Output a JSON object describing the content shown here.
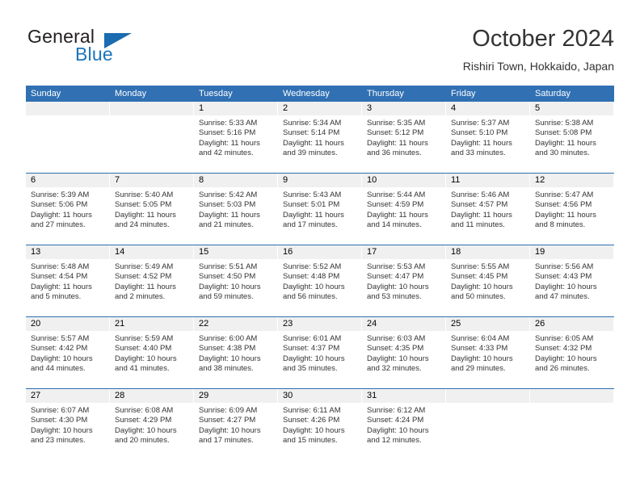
{
  "brand": {
    "name_part1": "General",
    "name_part2": "Blue"
  },
  "header": {
    "title": "October 2024",
    "subtitle": "Rishiri Town, Hokkaido, Japan"
  },
  "colors": {
    "header_blue": "#3070b3",
    "row_divider_blue": "#2f6fb0",
    "daynum_band": "#f0f0f0",
    "brand_blue": "#1b75bb",
    "text": "#333333"
  },
  "weekdays": [
    "Sunday",
    "Monday",
    "Tuesday",
    "Wednesday",
    "Thursday",
    "Friday",
    "Saturday"
  ],
  "weeks": [
    [
      {
        "day": "",
        "sunrise": "",
        "sunset": "",
        "daylight": "",
        "empty": true
      },
      {
        "day": "",
        "sunrise": "",
        "sunset": "",
        "daylight": "",
        "empty": true
      },
      {
        "day": "1",
        "sunrise": "Sunrise: 5:33 AM",
        "sunset": "Sunset: 5:16 PM",
        "daylight": "Daylight: 11 hours and 42 minutes."
      },
      {
        "day": "2",
        "sunrise": "Sunrise: 5:34 AM",
        "sunset": "Sunset: 5:14 PM",
        "daylight": "Daylight: 11 hours and 39 minutes."
      },
      {
        "day": "3",
        "sunrise": "Sunrise: 5:35 AM",
        "sunset": "Sunset: 5:12 PM",
        "daylight": "Daylight: 11 hours and 36 minutes."
      },
      {
        "day": "4",
        "sunrise": "Sunrise: 5:37 AM",
        "sunset": "Sunset: 5:10 PM",
        "daylight": "Daylight: 11 hours and 33 minutes."
      },
      {
        "day": "5",
        "sunrise": "Sunrise: 5:38 AM",
        "sunset": "Sunset: 5:08 PM",
        "daylight": "Daylight: 11 hours and 30 minutes."
      }
    ],
    [
      {
        "day": "6",
        "sunrise": "Sunrise: 5:39 AM",
        "sunset": "Sunset: 5:06 PM",
        "daylight": "Daylight: 11 hours and 27 minutes."
      },
      {
        "day": "7",
        "sunrise": "Sunrise: 5:40 AM",
        "sunset": "Sunset: 5:05 PM",
        "daylight": "Daylight: 11 hours and 24 minutes."
      },
      {
        "day": "8",
        "sunrise": "Sunrise: 5:42 AM",
        "sunset": "Sunset: 5:03 PM",
        "daylight": "Daylight: 11 hours and 21 minutes."
      },
      {
        "day": "9",
        "sunrise": "Sunrise: 5:43 AM",
        "sunset": "Sunset: 5:01 PM",
        "daylight": "Daylight: 11 hours and 17 minutes."
      },
      {
        "day": "10",
        "sunrise": "Sunrise: 5:44 AM",
        "sunset": "Sunset: 4:59 PM",
        "daylight": "Daylight: 11 hours and 14 minutes."
      },
      {
        "day": "11",
        "sunrise": "Sunrise: 5:46 AM",
        "sunset": "Sunset: 4:57 PM",
        "daylight": "Daylight: 11 hours and 11 minutes."
      },
      {
        "day": "12",
        "sunrise": "Sunrise: 5:47 AM",
        "sunset": "Sunset: 4:56 PM",
        "daylight": "Daylight: 11 hours and 8 minutes."
      }
    ],
    [
      {
        "day": "13",
        "sunrise": "Sunrise: 5:48 AM",
        "sunset": "Sunset: 4:54 PM",
        "daylight": "Daylight: 11 hours and 5 minutes."
      },
      {
        "day": "14",
        "sunrise": "Sunrise: 5:49 AM",
        "sunset": "Sunset: 4:52 PM",
        "daylight": "Daylight: 11 hours and 2 minutes."
      },
      {
        "day": "15",
        "sunrise": "Sunrise: 5:51 AM",
        "sunset": "Sunset: 4:50 PM",
        "daylight": "Daylight: 10 hours and 59 minutes."
      },
      {
        "day": "16",
        "sunrise": "Sunrise: 5:52 AM",
        "sunset": "Sunset: 4:48 PM",
        "daylight": "Daylight: 10 hours and 56 minutes."
      },
      {
        "day": "17",
        "sunrise": "Sunrise: 5:53 AM",
        "sunset": "Sunset: 4:47 PM",
        "daylight": "Daylight: 10 hours and 53 minutes."
      },
      {
        "day": "18",
        "sunrise": "Sunrise: 5:55 AM",
        "sunset": "Sunset: 4:45 PM",
        "daylight": "Daylight: 10 hours and 50 minutes."
      },
      {
        "day": "19",
        "sunrise": "Sunrise: 5:56 AM",
        "sunset": "Sunset: 4:43 PM",
        "daylight": "Daylight: 10 hours and 47 minutes."
      }
    ],
    [
      {
        "day": "20",
        "sunrise": "Sunrise: 5:57 AM",
        "sunset": "Sunset: 4:42 PM",
        "daylight": "Daylight: 10 hours and 44 minutes."
      },
      {
        "day": "21",
        "sunrise": "Sunrise: 5:59 AM",
        "sunset": "Sunset: 4:40 PM",
        "daylight": "Daylight: 10 hours and 41 minutes."
      },
      {
        "day": "22",
        "sunrise": "Sunrise: 6:00 AM",
        "sunset": "Sunset: 4:38 PM",
        "daylight": "Daylight: 10 hours and 38 minutes."
      },
      {
        "day": "23",
        "sunrise": "Sunrise: 6:01 AM",
        "sunset": "Sunset: 4:37 PM",
        "daylight": "Daylight: 10 hours and 35 minutes."
      },
      {
        "day": "24",
        "sunrise": "Sunrise: 6:03 AM",
        "sunset": "Sunset: 4:35 PM",
        "daylight": "Daylight: 10 hours and 32 minutes."
      },
      {
        "day": "25",
        "sunrise": "Sunrise: 6:04 AM",
        "sunset": "Sunset: 4:33 PM",
        "daylight": "Daylight: 10 hours and 29 minutes."
      },
      {
        "day": "26",
        "sunrise": "Sunrise: 6:05 AM",
        "sunset": "Sunset: 4:32 PM",
        "daylight": "Daylight: 10 hours and 26 minutes."
      }
    ],
    [
      {
        "day": "27",
        "sunrise": "Sunrise: 6:07 AM",
        "sunset": "Sunset: 4:30 PM",
        "daylight": "Daylight: 10 hours and 23 minutes."
      },
      {
        "day": "28",
        "sunrise": "Sunrise: 6:08 AM",
        "sunset": "Sunset: 4:29 PM",
        "daylight": "Daylight: 10 hours and 20 minutes."
      },
      {
        "day": "29",
        "sunrise": "Sunrise: 6:09 AM",
        "sunset": "Sunset: 4:27 PM",
        "daylight": "Daylight: 10 hours and 17 minutes."
      },
      {
        "day": "30",
        "sunrise": "Sunrise: 6:11 AM",
        "sunset": "Sunset: 4:26 PM",
        "daylight": "Daylight: 10 hours and 15 minutes."
      },
      {
        "day": "31",
        "sunrise": "Sunrise: 6:12 AM",
        "sunset": "Sunset: 4:24 PM",
        "daylight": "Daylight: 10 hours and 12 minutes."
      },
      {
        "day": "",
        "sunrise": "",
        "sunset": "",
        "daylight": "",
        "empty": true
      },
      {
        "day": "",
        "sunrise": "",
        "sunset": "",
        "daylight": "",
        "empty": true
      }
    ]
  ]
}
